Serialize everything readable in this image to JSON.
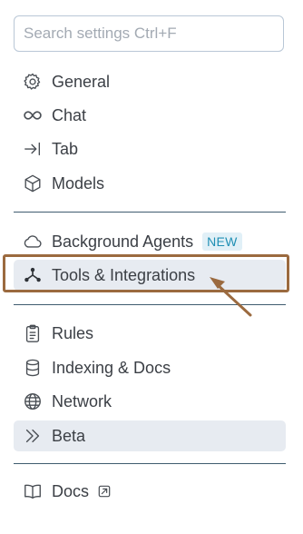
{
  "search": {
    "placeholder": "Search settings Ctrl+F",
    "value": ""
  },
  "nav": {
    "general": "General",
    "chat": "Chat",
    "tab": "Tab",
    "models": "Models",
    "background_agents": "Background Agents",
    "background_agents_badge": "NEW",
    "tools_integrations": "Tools & Integrations",
    "rules": "Rules",
    "indexing_docs": "Indexing & Docs",
    "network": "Network",
    "beta": "Beta",
    "docs": "Docs"
  },
  "selected": [
    "Tools & Integrations",
    "Beta"
  ],
  "colors": {
    "selected_background": "#e7ebf1",
    "annotation": "#9b6a3f",
    "badge_text": "#1f8fb4",
    "badge_background": "#e1f0f7",
    "divider": "#3f5c6f"
  },
  "icons": {
    "general": "gear-icon",
    "chat": "infinity-icon",
    "tab": "arrow-to-line-icon",
    "models": "cube-icon",
    "background_agents": "cloud-icon",
    "tools_integrations": "network-nodes-icon",
    "rules": "clipboard-icon",
    "indexing_docs": "database-icon",
    "network": "globe-icon",
    "beta": "double-chevron-right-icon",
    "docs": "open-book-icon",
    "docs_external": "external-link-icon"
  }
}
